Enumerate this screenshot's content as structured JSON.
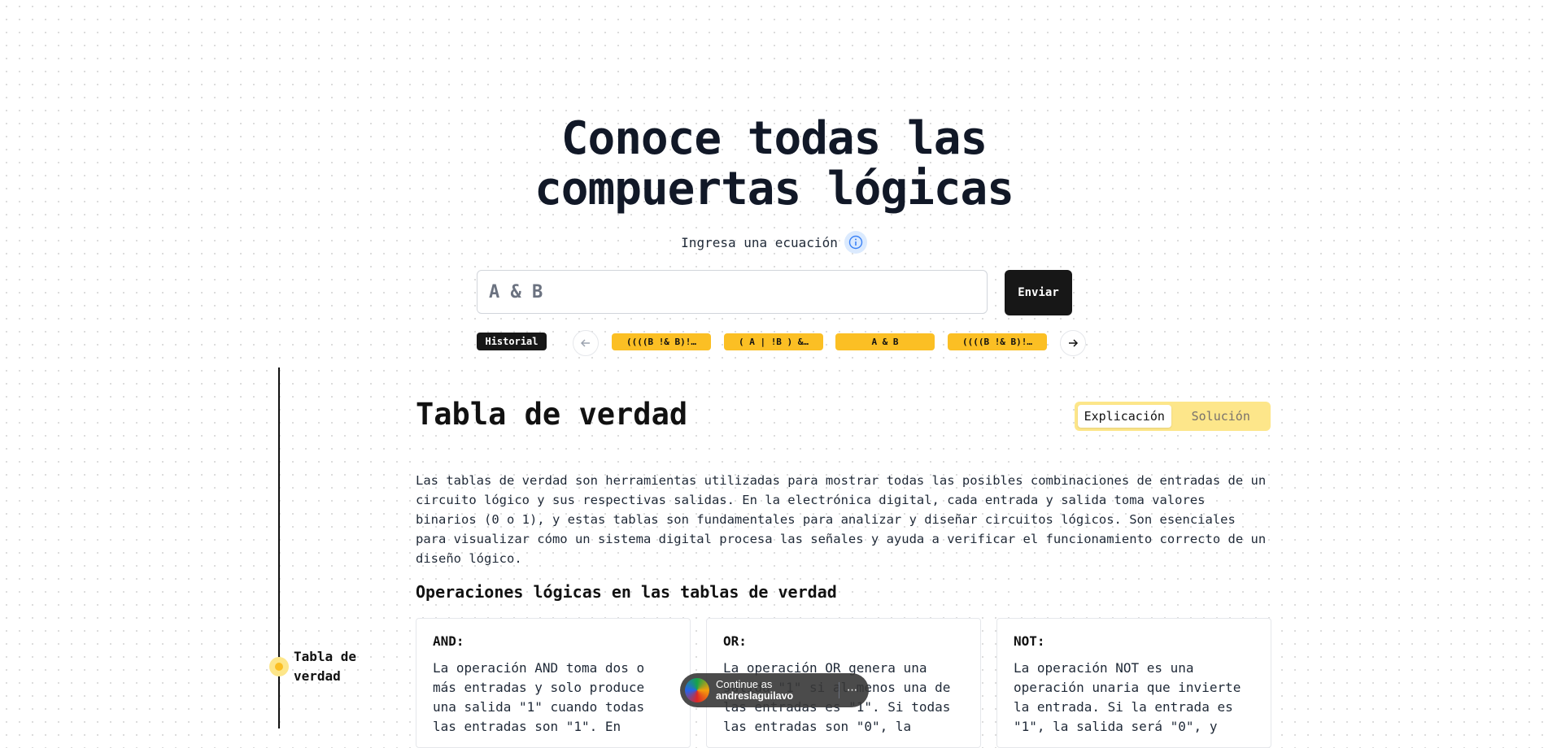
{
  "hero": {
    "title_line1": "Conoce todas las",
    "title_line2": "compuertas lógicas",
    "equation_label": "Ingresa una ecuación"
  },
  "search": {
    "placeholder": "A & B",
    "submit_label": "Enviar"
  },
  "history": {
    "label": "Historial",
    "items": [
      "((((B !& B)!…",
      "( A | !B ) &…",
      "A & B",
      "((((B !& B)!…"
    ]
  },
  "timeline": {
    "active_label": "Tabla de verdad"
  },
  "section": {
    "title": "Tabla de verdad",
    "tabs": [
      "Explicación",
      "Solución"
    ],
    "active_tab": "Explicación",
    "intro": "Las tablas de verdad son herramientas utilizadas para mostrar todas las posibles combinaciones de entradas de un circuito lógico y sus respectivas salidas. En la electrónica digital, cada entrada y salida toma valores binarios (0 o 1), y estas tablas son fundamentales para analizar y diseñar circuitos lógicos. Son esenciales para visualizar cómo un sistema digital procesa las señales y ayuda a verificar el funcionamiento correcto de un diseño lógico.",
    "subheading": "Operaciones lógicas en las tablas de verdad",
    "cards": [
      {
        "title": "AND:",
        "text": "La operación AND toma dos o más entradas y solo produce una salida \"1\" cuando todas las entradas son \"1\". En"
      },
      {
        "title": "OR:",
        "text": "La operación OR genera una salida \"1\" si al menos una de las entradas es \"1\". Si todas las entradas son \"0\", la"
      },
      {
        "title": "NOT:",
        "text": "La operación NOT es una operación unaria que invierte la entrada. Si la entrada es \"1\", la salida será \"0\", y"
      }
    ]
  },
  "continue_prompt": {
    "caption": "Continue as",
    "user": "andreslaguilavo",
    "more": "···"
  },
  "colors": {
    "accent": "#fbbf24",
    "accent_light": "#fde68a",
    "dark": "#171717",
    "info_bg": "#dbeafe"
  },
  "icons": [
    "info-icon",
    "arrow-left-icon",
    "arrow-right-icon",
    "more-icon",
    "avatar"
  ]
}
